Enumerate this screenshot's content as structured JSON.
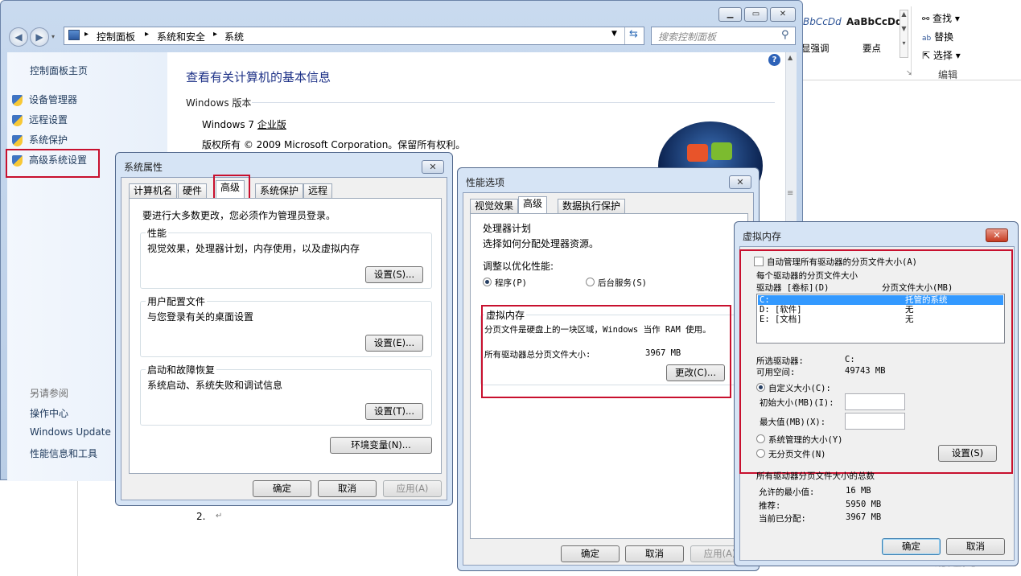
{
  "word": {
    "style1_preview": "BbCcDd",
    "style1_label": "显强调",
    "style2_preview": "AaBbCcDd",
    "style2_label": "要点",
    "find": "查找",
    "replace": "替换",
    "select": "选择",
    "group_label": "编辑",
    "list_item": "2.",
    "watermark": "易迅网"
  },
  "explorer": {
    "breadcrumb": [
      "控制面板",
      "系统和安全",
      "系统"
    ],
    "search_placeholder": "搜索控制面板",
    "sidebar": {
      "home": "控制面板主页",
      "items": [
        "设备管理器",
        "远程设置",
        "系统保护",
        "高级系统设置"
      ],
      "see_also": "另请参阅",
      "see_also_items": [
        "操作中心",
        "Windows Update",
        "性能信息和工具"
      ]
    },
    "main": {
      "title": "查看有关计算机的基本信息",
      "section": "Windows 版本",
      "edition_prefix": "Windows 7 ",
      "edition_link": "企业版",
      "copyright": "版权所有 © 2009 Microsoft Corporation。保留所有权利。"
    },
    "help_icon": "?"
  },
  "sysprops": {
    "title": "系统属性",
    "tabs": [
      "计算机名",
      "硬件",
      "高级",
      "系统保护",
      "远程"
    ],
    "admin_note": "要进行大多数更改，您必须作为管理员登录。",
    "perf_title": "性能",
    "perf_desc": "视觉效果，处理器计划，内存使用，以及虚拟内存",
    "perf_btn": "设置(S)...",
    "profile_title": "用户配置文件",
    "profile_desc": "与您登录有关的桌面设置",
    "profile_btn": "设置(E)...",
    "startup_title": "启动和故障恢复",
    "startup_desc": "系统启动、系统失败和调试信息",
    "startup_btn": "设置(T)...",
    "env_btn": "环境变量(N)...",
    "ok": "确定",
    "cancel": "取消",
    "apply": "应用(A)"
  },
  "perfopts": {
    "title": "性能选项",
    "tabs": [
      "视觉效果",
      "高级",
      "数据执行保护"
    ],
    "sched_title": "处理器计划",
    "sched_desc": "选择如何分配处理器资源。",
    "optimize": "调整以优化性能:",
    "opt_programs": "程序(P)",
    "opt_services": "后台服务(S)",
    "vm_title": "虚拟内存",
    "vm_desc": "分页文件是硬盘上的一块区域，Windows 当作 RAM 使用。",
    "vm_total_label": "所有驱动器总分页文件大小:",
    "vm_total_value": "3967 MB",
    "change_btn": "更改(C)...",
    "ok": "确定",
    "cancel": "取消",
    "apply": "应用(A)"
  },
  "vmem": {
    "title": "虚拟内存",
    "auto_manage": "自动管理所有驱动器的分页文件大小(A)",
    "per_drive": "每个驱动器的分页文件大小",
    "col_drive": "驱动器 [卷标](D)",
    "col_size": "分页文件大小(MB)",
    "drives": [
      {
        "drive": "C:",
        "size": "托管的系统"
      },
      {
        "drive": "D:   [软件]",
        "size": "无"
      },
      {
        "drive": "E:   [文档]",
        "size": "无"
      }
    ],
    "sel_drive_label": "所选驱动器:",
    "sel_drive_value": "C:",
    "free_label": "可用空间:",
    "free_value": "49743 MB",
    "custom": "自定义大小(C):",
    "initial": "初始大小(MB)(I):",
    "initial_value": "",
    "max": "最大值(MB)(X):",
    "max_value": "",
    "system_managed": "系统管理的大小(Y)",
    "no_paging": "无分页文件(N)",
    "set_btn": "设置(S)",
    "totals_title": "所有驱动器分页文件大小的总数",
    "min_label": "允许的最小值:",
    "min_value": "16 MB",
    "rec_label": "推荐:",
    "rec_value": "5950 MB",
    "cur_label": "当前已分配:",
    "cur_value": "3967 MB",
    "ok": "确定",
    "cancel": "取消"
  }
}
